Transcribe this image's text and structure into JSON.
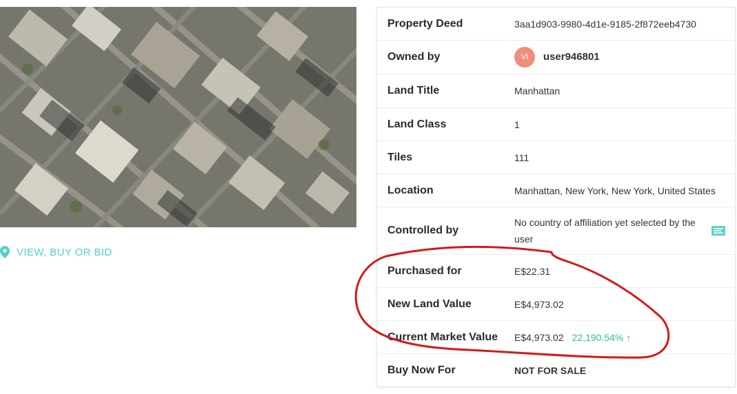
{
  "map": {
    "icon": "satellite-map-image"
  },
  "link": {
    "label": "VIEW, BUY OR BID",
    "icon": "map-pin-icon"
  },
  "deed": {
    "rows": [
      {
        "label": "Property Deed",
        "value": "3aa1d903-9980-4d1e-9185-2f872eeb4730"
      },
      {
        "label": "Owned by",
        "avatar": "VI",
        "value": "user946801"
      },
      {
        "label": "Land Title",
        "value": "Manhattan"
      },
      {
        "label": "Land Class",
        "value": "1"
      },
      {
        "label": "Tiles",
        "value": "111"
      },
      {
        "label": "Location",
        "value": "Manhattan, New York, New York, United States"
      },
      {
        "label": "Controlled by",
        "value": "No country of affiliation yet selected by the user",
        "icon": "flag-icon"
      },
      {
        "label": "Purchased for",
        "value": "E$22.31"
      },
      {
        "label": "New Land Value",
        "value": "E$4,973.02"
      },
      {
        "label": "Current Market Value",
        "value": "E$4,973.02",
        "change": "22,190.54%",
        "change_icon": "arrow-up-icon"
      },
      {
        "label": "Buy Now For",
        "value": "NOT FOR SALE"
      }
    ]
  },
  "colors": {
    "accent": "#4fd1c5",
    "avatar": "#ee8f7c",
    "gain": "#3bb99a",
    "annotation": "#d11a1a"
  }
}
